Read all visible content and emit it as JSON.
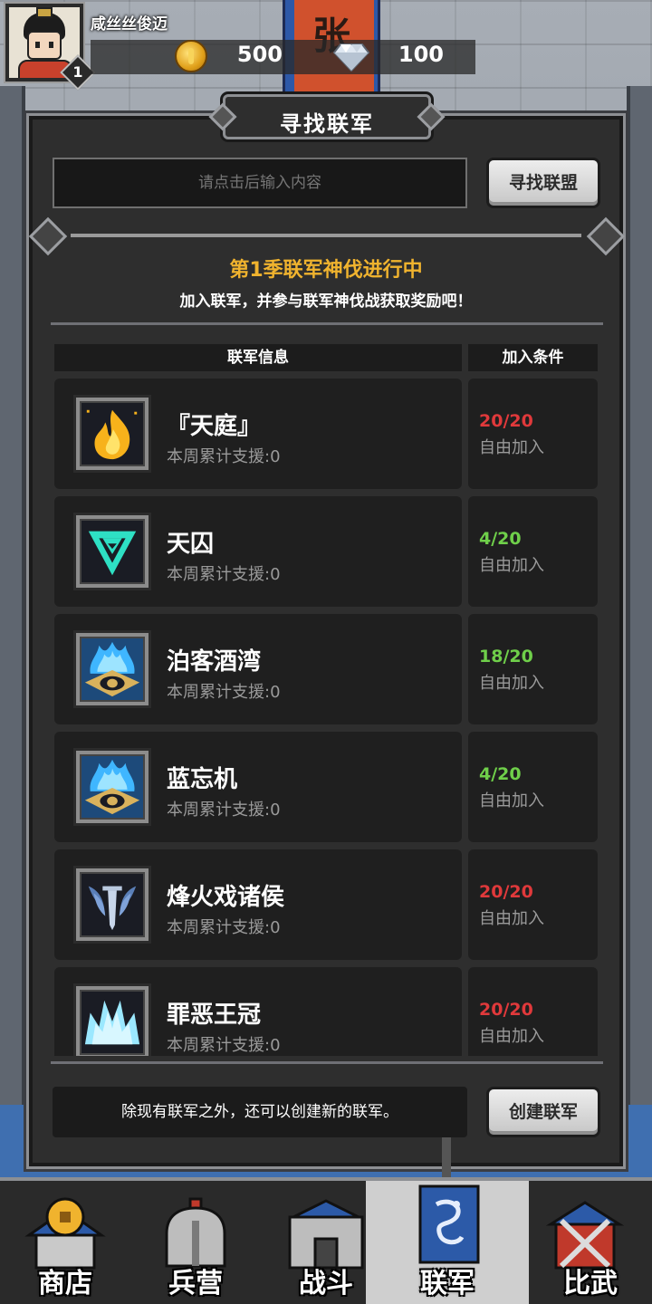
{
  "hud": {
    "player_name": "咸丝丝俊迈",
    "level": "1",
    "gold": "500",
    "diamonds": "100",
    "banner_char": "张"
  },
  "panel": {
    "title": "寻找联军",
    "search_placeholder": "请点击后输入内容",
    "search_button": "寻找联盟",
    "season_title": "第1季联军神伐进行中",
    "season_subtitle": "加入联军，并参与联军神伐战获取奖励吧！",
    "header_info": "联军信息",
    "header_condition": "加入条件",
    "footer_text": "除现有联军之外，还可以创建新的联军。",
    "create_button": "创建联军"
  },
  "alliances": [
    {
      "name": "『天庭』",
      "support": "本周累计支援:0",
      "members": "20/20",
      "members_color": "#e0393b",
      "join": "自由加入",
      "emblem": "flame-emblem"
    },
    {
      "name": "天囚",
      "support": "本周累计支援:0",
      "members": "4/20",
      "members_color": "#6fcf4a",
      "join": "自由加入",
      "emblem": "triangle-emblem"
    },
    {
      "name": "泊客酒湾",
      "support": "本周累计支援:0",
      "members": "18/20",
      "members_color": "#6fcf4a",
      "join": "自由加入",
      "emblem": "blue-flame-eye-emblem"
    },
    {
      "name": "蓝忘机",
      "support": "本周累计支援:0",
      "members": "4/20",
      "members_color": "#6fcf4a",
      "join": "自由加入",
      "emblem": "blue-flame-eye-emblem"
    },
    {
      "name": "烽火戏诸侯",
      "support": "本周累计支援:0",
      "members": "20/20",
      "members_color": "#e0393b",
      "join": "自由加入",
      "emblem": "winged-sword-emblem"
    },
    {
      "name": "罪恶王冠",
      "support": "本周累计支援:0",
      "members": "20/20",
      "members_color": "#e0393b",
      "join": "自由加入",
      "emblem": "ice-crown-emblem"
    }
  ],
  "nav": {
    "shop": "商店",
    "barracks": "兵营",
    "battle": "战斗",
    "alliance": "联军",
    "arena": "比武"
  }
}
